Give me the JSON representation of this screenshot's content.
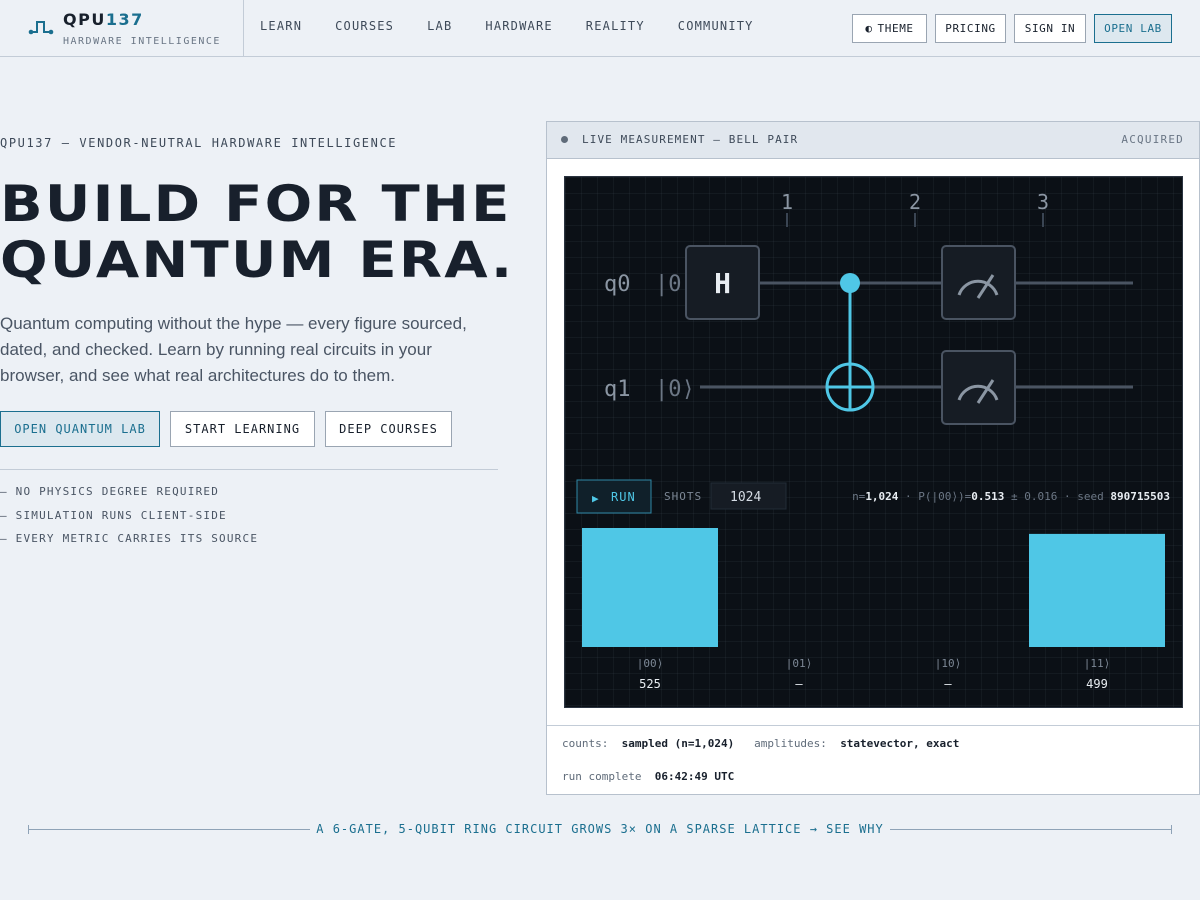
{
  "brand": {
    "name_main": "QPU",
    "name_accent": "137",
    "tagline": "HARDWARE INTELLIGENCE"
  },
  "nav": {
    "items": [
      "LEARN",
      "COURSES",
      "LAB",
      "HARDWARE",
      "REALITY",
      "COMMUNITY"
    ]
  },
  "header_actions": {
    "theme_icon": "◐",
    "theme": "THEME",
    "pricing": "PRICING",
    "sign_in": "SIGN IN",
    "open_lab": "OPEN LAB"
  },
  "hero": {
    "eyebrow": "QPU137 — VENDOR-NEUTRAL HARDWARE INTELLIGENCE",
    "title_line1": "BUILD FOR THE",
    "title_line2": "QUANTUM ERA.",
    "description": "Quantum computing without the hype — every figure sourced, dated, and checked. Learn by running real circuits in your browser, and see what real architectures do to them.",
    "cta_primary": "OPEN QUANTUM LAB",
    "cta_learning": "START LEARNING",
    "cta_courses": "DEEP COURSES",
    "bullets": [
      "— NO PHYSICS DEGREE REQUIRED",
      "— SIMULATION RUNS CLIENT-SIDE",
      "— EVERY METRIC CARRIES ITS SOURCE"
    ]
  },
  "lab": {
    "title": "LIVE MEASUREMENT — BELL PAIR",
    "status": "ACQUIRED",
    "circuit": {
      "steps": [
        "1",
        "2",
        "3"
      ],
      "qubits": [
        {
          "name": "q0",
          "state": "|0⟩"
        },
        {
          "name": "q1",
          "state": "|0⟩"
        }
      ],
      "h_gate": "H"
    },
    "run_label": "RUN",
    "run_icon": "▶",
    "shots_label": "SHOTS",
    "shots_value": "1024",
    "stats": {
      "n_prefix": "n=",
      "n_value": "1,024",
      "p_prefix": " · P(|00⟩)=",
      "p_value": "0.513",
      "err": " ± 0.016 · seed ",
      "seed": "890715503"
    },
    "footer": {
      "counts_label": "counts:",
      "counts_value": "sampled (n=1,024)",
      "amplitudes_label": "amplitudes:",
      "amplitudes_value": "statevector, exact",
      "run_label": "run complete",
      "run_time": "06:42:49 UTC"
    }
  },
  "chart_data": {
    "type": "bar",
    "categories": [
      "|00⟩",
      "|01⟩",
      "|10⟩",
      "|11⟩"
    ],
    "values": [
      525,
      0,
      0,
      499
    ],
    "value_labels": [
      "525",
      "—",
      "—",
      "499"
    ],
    "title": "",
    "xlabel": "",
    "ylabel": "",
    "grid": true,
    "colors": {
      "bar": "#4fc7e6"
    }
  },
  "banner": {
    "text": "A 6-GATE, 5-QUBIT RING CIRCUIT GROWS 3× ON A SPARSE LATTICE → SEE WHY"
  },
  "colors": {
    "accent": "#1b6f8f",
    "cyan": "#4fc7e6",
    "background": "#edf1f6",
    "screen": "#0b1016"
  }
}
